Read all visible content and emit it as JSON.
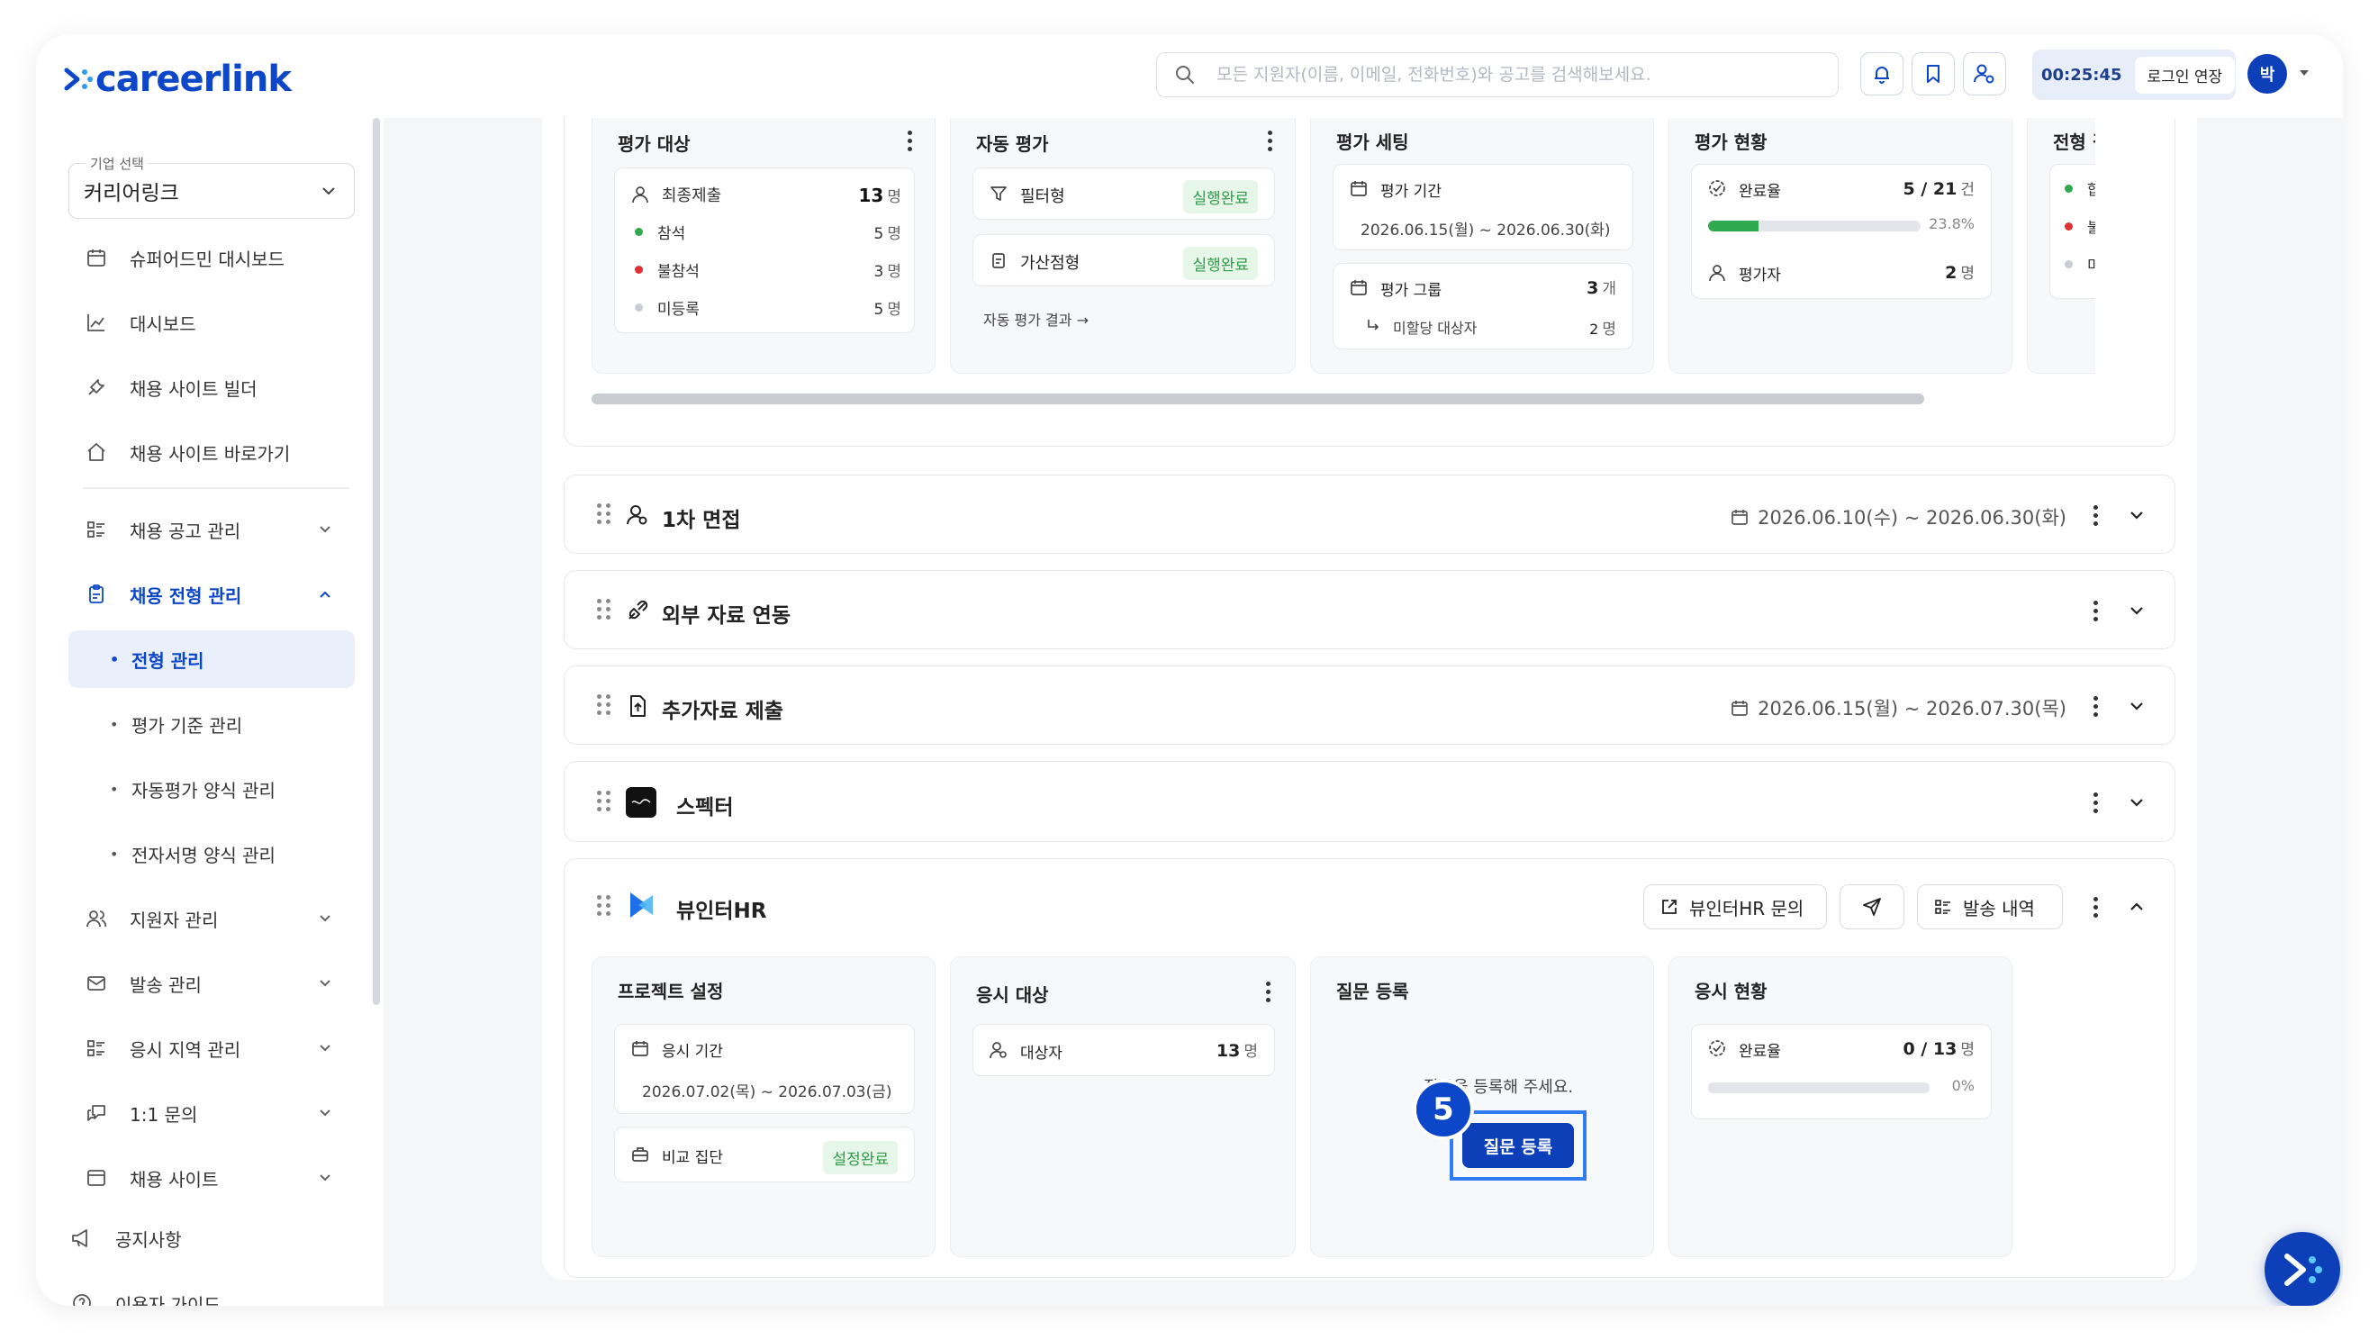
{
  "brand": {
    "name": "careerlink",
    "color": "#0d47c9"
  },
  "header": {
    "search_placeholder": "모든 지원자(이름, 이메일, 전화번호)와 공고를 검색해보세요.",
    "session_time": "00:25:45",
    "extend_login": "로그인 연장",
    "avatar": "박"
  },
  "sidebar": {
    "company_label": "기업 선택",
    "company_value": "커리어링크",
    "items": [
      {
        "label": "슈퍼어드민 대시보드",
        "icon": "calendar-icon"
      },
      {
        "label": "대시보드",
        "icon": "chart-icon"
      },
      {
        "label": "채용 사이트 빌더",
        "icon": "tools-icon"
      },
      {
        "label": "채용 사이트 바로가기",
        "icon": "home-icon"
      },
      {
        "label": "채용 공고 관리",
        "icon": "list-icon"
      },
      {
        "label": "채용 전형 관리",
        "icon": "clipboard-icon"
      },
      {
        "label": "지원자 관리",
        "icon": "users-icon"
      },
      {
        "label": "발송 관리",
        "icon": "mail-icon"
      },
      {
        "label": "응시 지역 관리",
        "icon": "list-icon"
      },
      {
        "label": "1:1 문의",
        "icon": "chat-icon"
      },
      {
        "label": "채용 사이트",
        "icon": "window-icon"
      }
    ],
    "sub_items": [
      "전형 관리",
      "평가 기준 관리",
      "자동평가 양식 관리",
      "전자서명 양식 관리"
    ],
    "footer": [
      "공지사항",
      "이용자 가이드"
    ]
  },
  "eval_panel": {
    "target": {
      "title": "평가 대상",
      "final_label": "최종제출",
      "final_val": "13",
      "unit": "명",
      "rows": [
        {
          "label": "참석",
          "val": "5",
          "color": "#2fa84f"
        },
        {
          "label": "불참석",
          "val": "3",
          "color": "#e03131"
        },
        {
          "label": "미등록",
          "val": "5",
          "color": "#c9ccd2"
        }
      ]
    },
    "auto": {
      "title": "자동 평가",
      "filter": "필터형",
      "bonus": "가산점형",
      "status": "실행완료",
      "result_link": "자동 평가 결과 →"
    },
    "setting": {
      "title": "평가 세팅",
      "period_label": "평가 기간",
      "period": "2026.06.15(월) ~ 2026.06.30(화)",
      "group_label": "평가 그룹",
      "group_val": "3",
      "group_unit": "개",
      "unassigned_label": "미할당 대상자",
      "unassigned_val": "2",
      "unassigned_unit": "명"
    },
    "status": {
      "title": "평가 현황",
      "rate_label": "완료율",
      "rate_val": "5 / 21",
      "rate_unit": "건",
      "rate_pct": "23.8%",
      "rate_fraction": 0.238,
      "evaluator_label": "평가자",
      "evaluator_val": "2",
      "evaluator_unit": "명"
    },
    "result": {
      "title": "전형 결과",
      "rows": [
        "합격",
        "불합격",
        "미등록"
      ]
    }
  },
  "stages": {
    "interview": {
      "title": "1차 면접",
      "date": "2026.06.10(수) ~ 2026.06.30(화)"
    },
    "external": {
      "title": "외부 자료 연동"
    },
    "docs": {
      "title": "추가자료 제출",
      "date": "2026.06.15(월) ~ 2026.07.30(목)"
    },
    "specter": {
      "title": "스펙터"
    },
    "viewinter": {
      "title": "뷰인터HR",
      "inquiry_btn": "뷰인터HR 문의",
      "history_btn": "발송 내역",
      "project": {
        "title": "프로젝트 설정",
        "period_label": "응시 기간",
        "period": "2026.07.02(목) ~ 2026.07.03(금)",
        "compare_label": "비교 집단",
        "compare_status": "설정완료"
      },
      "target": {
        "title": "응시 대상",
        "label": "대상자",
        "val": "13",
        "unit": "명"
      },
      "question": {
        "title": "질문 등록",
        "empty_text": "질문을 등록해 주세요.",
        "button": "질문 등록"
      },
      "status": {
        "title": "응시 현황",
        "rate_label": "완료율",
        "rate_val": "0 / 13",
        "rate_unit": "명",
        "rate_pct": "0%",
        "rate_fraction": 0
      }
    }
  },
  "tutorial": {
    "step": "5"
  }
}
